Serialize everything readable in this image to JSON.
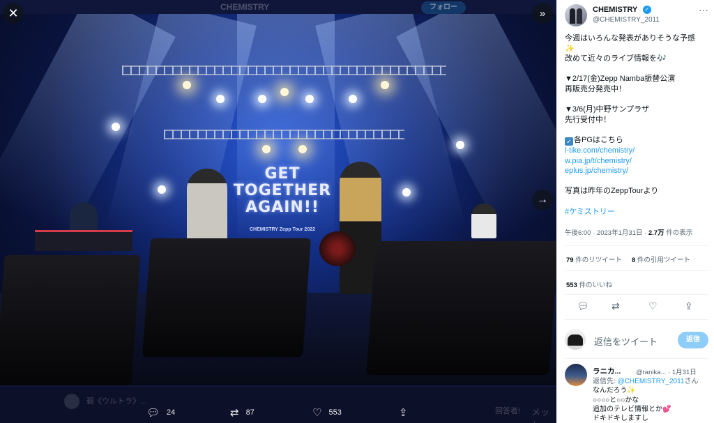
{
  "viewer": {
    "close_icon": "close-icon",
    "expand_icon": "double-chevron-right-icon",
    "next_icon": "arrow-right-icon",
    "photo": {
      "stage_title": "GET\nTOGETHER\nAGAIN!!",
      "stage_subtitle": "CHEMISTRY Zepp Tour 2022"
    },
    "behind_header": {
      "name": "CHEMISTRY",
      "follow": "フォロー"
    },
    "behind_row": {
      "name": "碧《ウルトラ》...",
      "right": "メッセ",
      "snippet": "回答者!"
    },
    "actions": {
      "reply_count": "24",
      "retweet_count": "87",
      "like_count": "553"
    }
  },
  "tweet": {
    "author_name": "CHEMISTRY",
    "author_handle": "@CHEMISTRY_2011",
    "lines": {
      "l1": "今週はいろんな発表がありそうな予感",
      "l2": "✨",
      "l3a": "改めて近々のライブ情報を",
      "l3b": "🎶",
      "l4": "▼2/17(金)Zepp Namba振替公演",
      "l5": "再販売分発売中！",
      "l6": "▼3/6(月)中野サンプラザ",
      "l7": "先行受付中！",
      "l8": "各PGはこちら",
      "link1": "l-tike.com/chemistry/",
      "link2": "w.pia.jp/t/chemistry/",
      "link3": "eplus.jp/chemistry/",
      "l9": "写真は昨年のZeppTourより",
      "hashtag": "#ケミストリー"
    },
    "meta": {
      "time": "午後6:00 · 2023年1月31日 · ",
      "views_value": "2.7万",
      "views_label": " 件の表示"
    },
    "stats": {
      "retweets_value": "79",
      "retweets_label": " 件のリツイート",
      "quotes_value": "8",
      "quotes_label": " 件の引用ツイート",
      "likes_value": "553",
      "likes_label": " 件のいいね"
    }
  },
  "reply_composer": {
    "placeholder": "返信をツイート",
    "button": "返信"
  },
  "reply": {
    "name": "ラニカ...",
    "handle": "@ranika... · 1月31日",
    "to_prefix": "返信先: ",
    "to_handle": "@CHEMISTRY_2011",
    "to_suffix": "さん",
    "line1": "なんだろう",
    "line1_emoji": "✨",
    "line2": "○○○○と○○かな",
    "line3": "追加のテレビ情報とか",
    "line3_emoji": "💕",
    "line4": "ドキドキしますし"
  }
}
